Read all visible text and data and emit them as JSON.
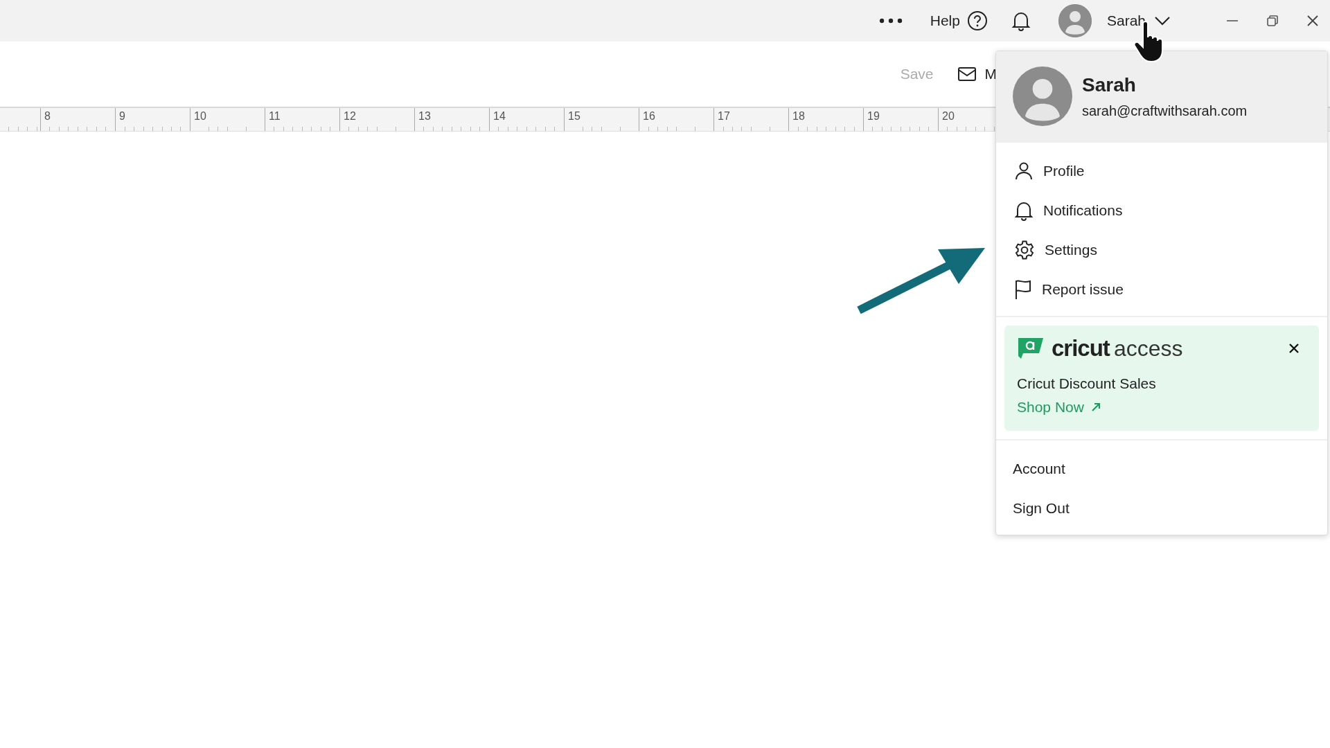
{
  "topbar": {
    "help": "Help",
    "user_name": "Sarah"
  },
  "toolbar": {
    "save": {
      "label": "Save",
      "disabled": true
    },
    "mail_label": "M"
  },
  "ruler": {
    "labels": [
      "8",
      "9",
      "10",
      "11",
      "12",
      "13",
      "14",
      "15",
      "16",
      "17",
      "18",
      "19",
      "20"
    ]
  },
  "user_menu": {
    "name": "Sarah",
    "email": "sarah@craftwithsarah.com",
    "items": [
      {
        "label": "Profile"
      },
      {
        "label": "Notifications"
      },
      {
        "label": "Settings"
      },
      {
        "label": "Report issue"
      }
    ],
    "promo": {
      "brand": "cricut",
      "brand_suffix": "access",
      "title": "Cricut Discount Sales",
      "link": "Shop Now"
    },
    "footer_items": [
      "Account",
      "Sign Out"
    ]
  }
}
